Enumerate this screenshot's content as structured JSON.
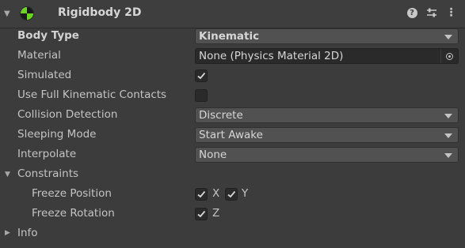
{
  "component": {
    "title": "Rigidbody 2D",
    "icons": {
      "fold": "chevron-down-icon",
      "component": "rigidbody2d-icon",
      "help": "help-icon",
      "presets": "presets-icon",
      "menu": "more-menu-icon"
    },
    "help_glyph": "?",
    "menu_glyph": "⋮"
  },
  "fields": {
    "body_type": {
      "label": "Body Type",
      "value": "Kinematic"
    },
    "material": {
      "label": "Material",
      "value": "None (Physics Material 2D)"
    },
    "simulated": {
      "label": "Simulated",
      "checked": true
    },
    "full_kinematic_contacts": {
      "label": "Use Full Kinematic Contacts",
      "checked": false
    },
    "collision_detection": {
      "label": "Collision Detection",
      "value": "Discrete"
    },
    "sleeping_mode": {
      "label": "Sleeping Mode",
      "value": "Start Awake"
    },
    "interpolate": {
      "label": "Interpolate",
      "value": "None"
    }
  },
  "constraints": {
    "label": "Constraints",
    "freeze_position": {
      "label": "Freeze Position",
      "x_label": "X",
      "y_label": "Y",
      "x": true,
      "y": true
    },
    "freeze_rotation": {
      "label": "Freeze Rotation",
      "z_label": "Z",
      "z": true
    }
  },
  "info": {
    "label": "Info"
  },
  "colors": {
    "background": "#3c3c3c",
    "field": "#515151",
    "object_field": "#2a2a2a",
    "text": "#c4c4c4",
    "icon_green": "#6bd321"
  }
}
